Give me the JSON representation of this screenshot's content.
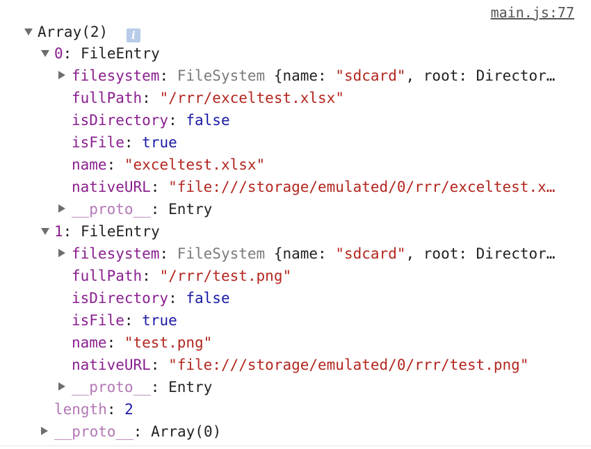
{
  "source_link": "main.js:77",
  "root": {
    "label": "Array(2)",
    "info_icon": "i"
  },
  "entries": [
    {
      "index": "0",
      "type": "FileEntry",
      "filesystem": {
        "key": "filesystem",
        "type": "FileSystem",
        "brace": "{name: ",
        "name_val": "\"sdcard\"",
        "rest": ", root: Director…"
      },
      "fullPath": {
        "key": "fullPath",
        "value": "\"/rrr/exceltest.xlsx\""
      },
      "isDirectory": {
        "key": "isDirectory",
        "value": "false"
      },
      "isFile": {
        "key": "isFile",
        "value": "true"
      },
      "name": {
        "key": "name",
        "value": "\"exceltest.xlsx\""
      },
      "nativeURL": {
        "key": "nativeURL",
        "value": "\"file:///storage/emulated/0/rrr/exceltest.x…"
      },
      "proto": {
        "key": "__proto__",
        "value": "Entry"
      }
    },
    {
      "index": "1",
      "type": "FileEntry",
      "filesystem": {
        "key": "filesystem",
        "type": "FileSystem",
        "brace": "{name: ",
        "name_val": "\"sdcard\"",
        "rest": ", root: Director…"
      },
      "fullPath": {
        "key": "fullPath",
        "value": "\"/rrr/test.png\""
      },
      "isDirectory": {
        "key": "isDirectory",
        "value": "false"
      },
      "isFile": {
        "key": "isFile",
        "value": "true"
      },
      "name": {
        "key": "name",
        "value": "\"test.png\""
      },
      "nativeURL": {
        "key": "nativeURL",
        "value": "\"file:///storage/emulated/0/rrr/test.png\""
      },
      "proto": {
        "key": "__proto__",
        "value": "Entry"
      }
    }
  ],
  "length": {
    "key": "length",
    "value": "2"
  },
  "array_proto": {
    "key": "__proto__",
    "value": "Array(0)"
  },
  "separator": ": ",
  "colors": {
    "key": "#8a1f8f",
    "key_dim": "#b277b5",
    "string": "#b3261e",
    "keyword": "#1a1aa6",
    "object": "#7a7a7a"
  },
  "icons": {
    "expanded": "triangle-down-icon",
    "collapsed": "triangle-right-icon",
    "info": "info-icon"
  }
}
